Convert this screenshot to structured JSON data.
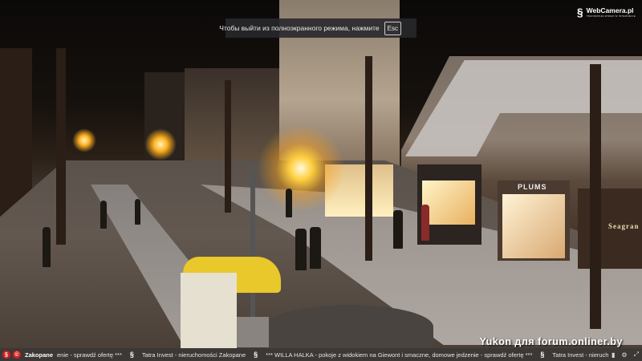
{
  "fullscreen_notice": {
    "text": "Чтобы выйти из полноэкранного режима, нажмите",
    "key": "Esc"
  },
  "logo": {
    "name": "WebCamera.pl",
    "tagline": "TRANSMISJE WIDEO W INTERNECIE"
  },
  "watermark": "Yukon для forum.onliner.by",
  "shop_signs": {
    "plums": "PLUMS",
    "seagran": "Seagran"
  },
  "ticker": {
    "city": "Zakopane",
    "items": [
      "enie - sprawdź ofertę ***",
      "Tatra Invest - nieruchomości Zakopane",
      "*** WILLA HALKA - pokoje z widokiem na Giewont i smaczne, domowe jedzenie - sprawdź ofertę ***",
      "Tatra Invest - nieruchomości Za"
    ]
  },
  "colors": {
    "badge": "#d42020",
    "ticker_bg": "#3c3836",
    "lamp_glow": "#ffcf40"
  }
}
